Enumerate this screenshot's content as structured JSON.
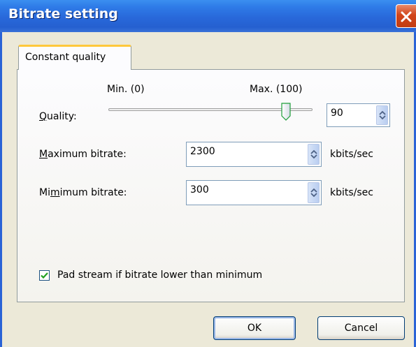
{
  "window": {
    "title": "Bitrate setting"
  },
  "tabs": [
    {
      "label": "Constant quality"
    }
  ],
  "quality": {
    "label": "Quality:",
    "min_label": "Min. (0)",
    "max_label": "Max. (100)",
    "slider_value": 90,
    "value": "90"
  },
  "max_bitrate": {
    "label": "Maximum bitrate:",
    "value": "2300",
    "unit": "kbits/sec"
  },
  "min_bitrate": {
    "label": "Mimimum bitrate:",
    "value": "300",
    "unit": "kbits/sec"
  },
  "pad_stream": {
    "label": "Pad stream if bitrate lower than minimum",
    "checked": true
  },
  "buttons": {
    "ok": "OK",
    "cancel": "Cancel"
  },
  "colors": {
    "title_bar": "#2868da",
    "close_button": "#d2451a",
    "tab_accent": "#ffc83c",
    "checkmark": "#21a121"
  }
}
